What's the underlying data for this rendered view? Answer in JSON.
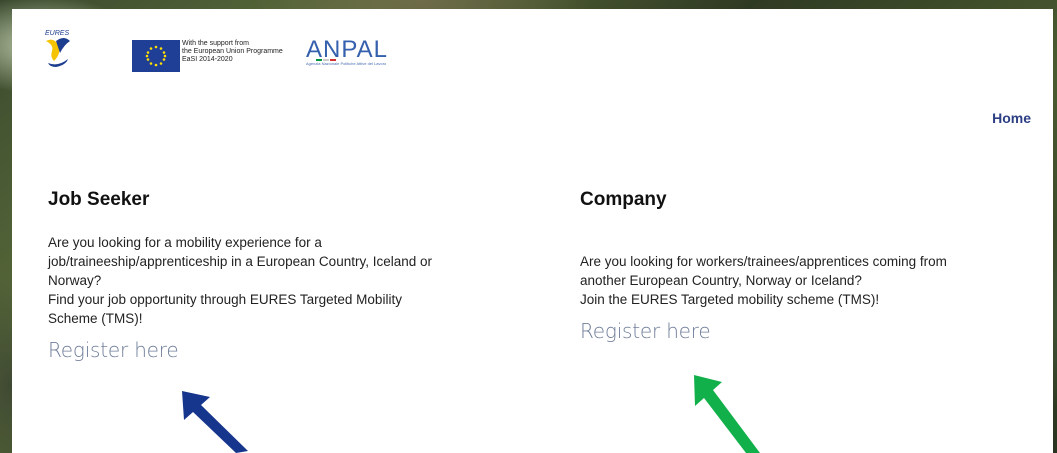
{
  "header": {
    "eu_text_lines": [
      "With the support from",
      "the European Union Programme",
      "EaSI 2014-2020"
    ],
    "eures_logo_text": "EURES",
    "anpal_logo_text": "ANPAL",
    "anpal_subtitle": "Agenzia Nazionale Politiche Attive del Lavoro"
  },
  "nav": {
    "home_label": "Home"
  },
  "job_seeker": {
    "title": "Job Seeker",
    "lines": [
      "Are you looking for a mobility experience for a",
      "job/traineeship/apprenticeship in a European Country, Iceland or",
      "Norway?",
      "Find your job opportunity through EURES Targeted Mobility",
      "Scheme (TMS)!"
    ],
    "register_label": "Register here"
  },
  "company": {
    "title": "Company",
    "lines": [
      "Are you looking for workers/trainees/apprentices coming from",
      "another European Country, Norway or Iceland?",
      "Join the EURES Targeted mobility scheme (TMS)!"
    ],
    "register_label": "Register here"
  },
  "colors": {
    "blue_arrow": "#16358c",
    "green_arrow": "#12b04a",
    "link": "#6f7d99",
    "home": "#2c3f83"
  }
}
